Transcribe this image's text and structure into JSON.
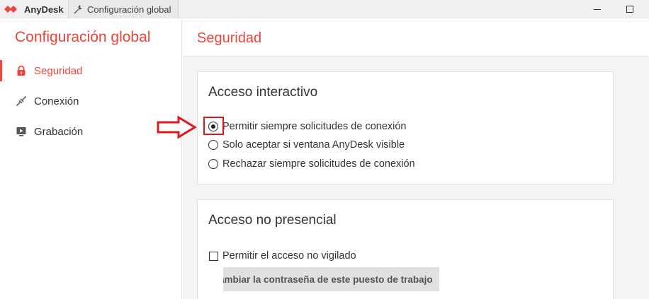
{
  "titlebar": {
    "app_name": "AnyDesk",
    "tab_label": "Configuración global",
    "accent": "#ef443b"
  },
  "sidebar": {
    "title": "Configuración global",
    "items": [
      {
        "label": "Seguridad",
        "icon": "lock-icon",
        "active": true
      },
      {
        "label": "Conexión",
        "icon": "connection-icon",
        "active": false
      },
      {
        "label": "Grabación",
        "icon": "recording-icon",
        "active": false
      }
    ]
  },
  "main": {
    "page_title": "Seguridad",
    "interactive_access": {
      "title": "Acceso interactivo",
      "options": [
        {
          "label": "Permitir siempre solicitudes de conexión",
          "checked": true
        },
        {
          "label": "Solo aceptar si ventana AnyDesk visible",
          "checked": false
        },
        {
          "label": "Rechazar siempre solicitudes de conexión",
          "checked": false
        }
      ]
    },
    "unattended_access": {
      "title": "Acceso no presencial",
      "checkbox_label": "Permitir el acceso no vigilado",
      "checkbox_checked": false,
      "button_label": "ambiar la contraseña de este puesto de trabajo"
    }
  },
  "annotation": {
    "arrow_color": "#d9191f"
  }
}
